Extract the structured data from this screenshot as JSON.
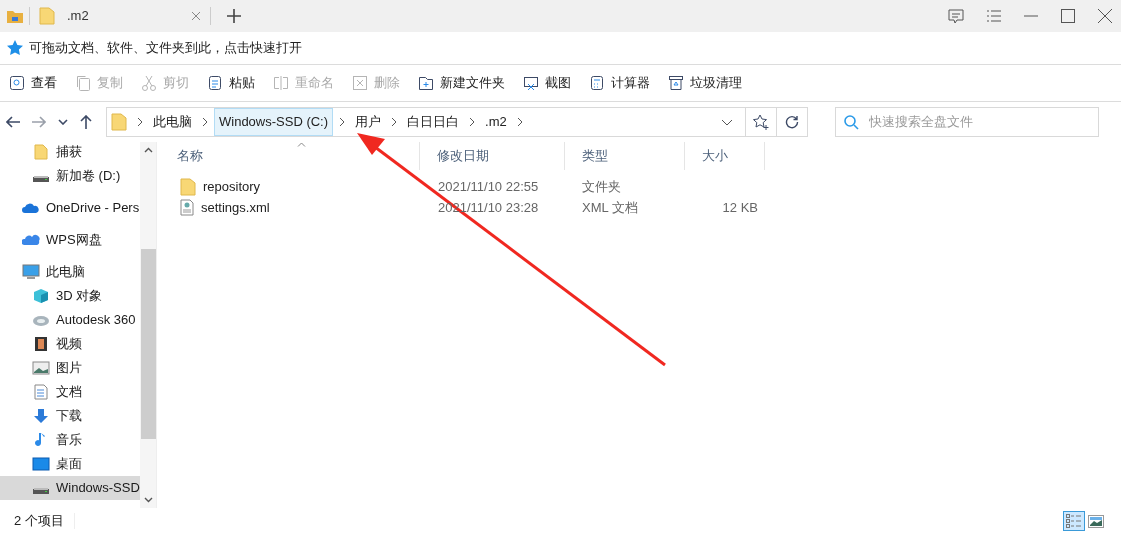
{
  "tabs": [
    {
      "label": ".m2",
      "selected": true
    }
  ],
  "tip": "可拖动文档、软件、文件夹到此，点击快速打开",
  "toolbar": [
    {
      "label": "查看",
      "kind": "view",
      "disabled": false
    },
    {
      "label": "复制",
      "kind": "copy",
      "disabled": true
    },
    {
      "label": "剪切",
      "kind": "cut",
      "disabled": true
    },
    {
      "label": "粘贴",
      "kind": "paste",
      "disabled": false
    },
    {
      "label": "重命名",
      "kind": "rename",
      "disabled": true
    },
    {
      "label": "删除",
      "kind": "delete",
      "disabled": true
    },
    {
      "label": "新建文件夹",
      "kind": "newfolder",
      "disabled": false
    },
    {
      "label": "截图",
      "kind": "screenshot",
      "disabled": false
    },
    {
      "label": "计算器",
      "kind": "calculator",
      "disabled": false
    },
    {
      "label": "垃圾清理",
      "kind": "cleanup",
      "disabled": false
    }
  ],
  "breadcrumb": [
    {
      "label": "此电脑",
      "highlighted": false
    },
    {
      "label": "Windows-SSD (C:)",
      "highlighted": true
    },
    {
      "label": "用户",
      "highlighted": false
    },
    {
      "label": "白日日白",
      "highlighted": false
    },
    {
      "label": ".m2",
      "highlighted": false
    }
  ],
  "search": {
    "placeholder": "快速搜索全盘文件"
  },
  "sidebar": [
    {
      "children": [
        {
          "label": "捕获",
          "kind": "folder",
          "selected": false
        },
        {
          "label": "新加卷 (D:)",
          "kind": "drive",
          "selected": false
        }
      ]
    },
    {
      "label": "OneDrive - Pers",
      "kind": "cloud",
      "selected": false
    },
    {
      "label": "WPS网盘",
      "kind": "cloud2",
      "selected": false
    },
    {
      "label": "此电脑",
      "kind": "computer",
      "selected": false,
      "children": [
        {
          "label": "3D 对象",
          "kind": "cube",
          "selected": false
        },
        {
          "label": "Autodesk 360",
          "kind": "swirl",
          "selected": false
        },
        {
          "label": "视频",
          "kind": "film",
          "selected": false
        },
        {
          "label": "图片",
          "kind": "image",
          "selected": false
        },
        {
          "label": "文档",
          "kind": "document",
          "selected": false
        },
        {
          "label": "下载",
          "kind": "download",
          "selected": false
        },
        {
          "label": "音乐",
          "kind": "music",
          "selected": false
        },
        {
          "label": "桌面",
          "kind": "desktop",
          "selected": false
        },
        {
          "label": "Windows-SSD",
          "kind": "drive",
          "selected": true
        }
      ]
    }
  ],
  "table": {
    "columns": [
      "名称",
      "修改日期",
      "类型",
      "大小"
    ],
    "rows": [
      {
        "kind": "folder",
        "cells": [
          "repository",
          "2021/11/10 22:55",
          "文件夹",
          ""
        ]
      },
      {
        "kind": "xml",
        "cells": [
          "settings.xml",
          "2021/11/10 23:28",
          "XML 文档",
          "12 KB"
        ]
      }
    ]
  },
  "status_bar": {
    "count": "2 个项目",
    "views": [
      {
        "kind": "details",
        "selected": true
      },
      {
        "kind": "thumbnails",
        "selected": false
      }
    ]
  }
}
